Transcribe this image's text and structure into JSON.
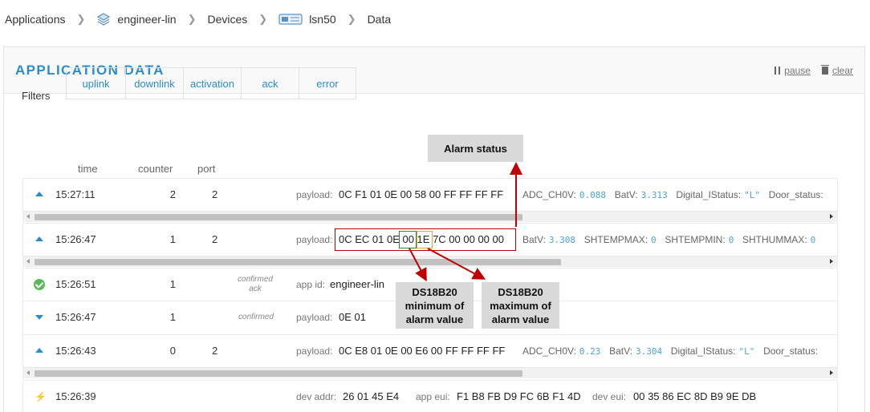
{
  "breadcrumb": {
    "applications": "Applications",
    "app": "engineer-lin",
    "devices": "Devices",
    "device": "lsn50",
    "data": "Data"
  },
  "panel": {
    "title": "APPLICATION DATA",
    "pause": "pause",
    "clear": "clear"
  },
  "filters": {
    "label": "Filters",
    "buttons": [
      "uplink",
      "downlink",
      "activation",
      "ack",
      "error"
    ]
  },
  "columns": {
    "time": "time",
    "counter": "counter",
    "port": "port"
  },
  "rows": [
    {
      "type": "uplink",
      "time": "15:27:11",
      "counter": "2",
      "port": "2",
      "payload_label": "payload:",
      "payload": "0C F1 01 0E 00 58 00 FF FF FF FF",
      "fields": [
        [
          "ADC_CH0V:",
          "0.088"
        ],
        [
          "BatV:",
          "3.313"
        ],
        [
          "Digital_IStatus:",
          "\"L\""
        ],
        [
          "Door_status:",
          ""
        ]
      ]
    },
    {
      "type": "uplink",
      "time": "15:26:47",
      "counter": "1",
      "port": "2",
      "payload_label": "payload:",
      "payload": "0C EC 01 0E 00 1E 7C 00 00 00 00",
      "fields": [
        [
          "BatV:",
          "3.308"
        ],
        [
          "SHTEMPMAX:",
          "0"
        ],
        [
          "SHTEMPMIN:",
          "0"
        ],
        [
          "SHTHUMMAX:",
          "0"
        ]
      ]
    },
    {
      "type": "ack",
      "time": "15:26:51",
      "counter": "1",
      "confirmed1": "confirmed",
      "confirmed2": "ack",
      "label": "app id:",
      "value": "engineer-lin"
    },
    {
      "type": "downlink",
      "time": "15:26:47",
      "counter": "1",
      "confirmed": "confirmed",
      "payload_label": "payload:",
      "payload": "0E 01"
    },
    {
      "type": "uplink",
      "time": "15:26:43",
      "counter": "0",
      "port": "2",
      "payload_label": "payload:",
      "payload": "0C E8 01 0E 00 E6 00 FF FF FF FF",
      "fields": [
        [
          "ADC_CH0V:",
          "0.23"
        ],
        [
          "BatV:",
          "3.304"
        ],
        [
          "Digital_IStatus:",
          "\"L\""
        ],
        [
          "Door_status:",
          ""
        ]
      ]
    },
    {
      "type": "activation",
      "time": "15:26:39",
      "devaddr_label": "dev addr:",
      "devaddr": "26 01 45 E4",
      "appeui_label": "app eui:",
      "appeui": "F1 B8 FB D9 FC 6B F1 4D",
      "deveui_label": "dev eui:",
      "deveui": "00 35 86 EC 8D B9 9E DB"
    }
  ],
  "annotations": {
    "alarm_status": "Alarm status",
    "min_line1": "DS18B20",
    "min_line2": "minimum of",
    "min_line3": "alarm value",
    "max_line1": "DS18B20",
    "max_line2": "maximum of",
    "max_line3": "alarm value"
  },
  "colors": {
    "accent": "#2a8cd0",
    "annotation_red": "#c00000",
    "green": "#2e8b2e",
    "orange": "#f0a030"
  }
}
